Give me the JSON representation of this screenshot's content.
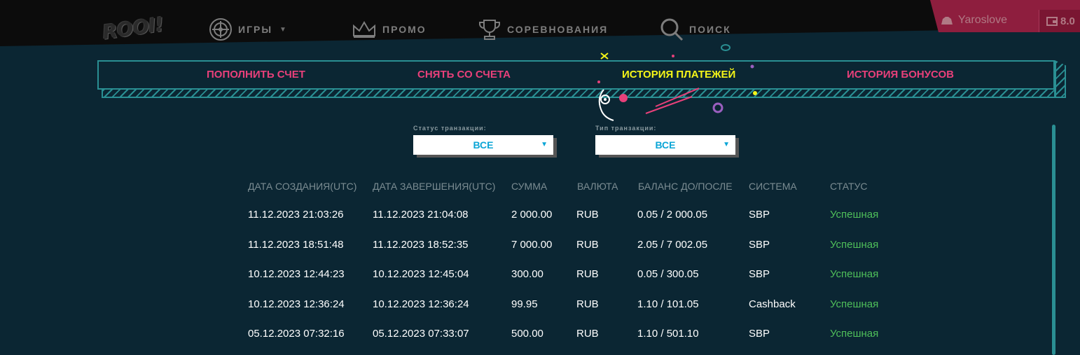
{
  "header": {
    "logo": "ROOI!",
    "nav": [
      {
        "label": "ИГРЫ",
        "icon": "roulette-icon",
        "has_dropdown": true
      },
      {
        "label": "ПРОМО",
        "icon": "crown-icon"
      },
      {
        "label": "СОРЕВНОВАНИЯ",
        "icon": "trophy-icon"
      },
      {
        "label": "ПОИСК",
        "icon": "search-icon"
      }
    ],
    "username": "Yaroslove",
    "balance": "8.0"
  },
  "tabs": [
    {
      "label": "ПОПОЛНИТЬ СЧЕТ",
      "active": false
    },
    {
      "label": "СНЯТЬ СО СЧЕТА",
      "active": false
    },
    {
      "label": "ИСТОРИЯ ПЛАТЕЖЕЙ",
      "active": true
    },
    {
      "label": "ИСТОРИЯ БОНУСОВ",
      "active": false
    }
  ],
  "filters": {
    "status": {
      "label": "Статус транзакции:",
      "value": "ВСЕ"
    },
    "type": {
      "label": "Тип транзакции:",
      "value": "ВСЕ"
    }
  },
  "table": {
    "columns": [
      "ДАТА СОЗДАНИЯ(UTC)",
      "ДАТА ЗАВЕРШЕНИЯ(UTC)",
      "СУММА",
      "ВАЛЮТА",
      "БАЛАНС ДО/ПОСЛЕ",
      "СИСТЕМА",
      "СТАТУС"
    ],
    "rows": [
      [
        "11.12.2023 21:03:26",
        "11.12.2023 21:04:08",
        "2 000.00",
        "RUB",
        "0.05 / 2 000.05",
        "SBP",
        "Успешная"
      ],
      [
        "11.12.2023 18:51:48",
        "11.12.2023 18:52:35",
        "7 000.00",
        "RUB",
        "2.05 / 7 002.05",
        "SBP",
        "Успешная"
      ],
      [
        "10.12.2023 12:44:23",
        "10.12.2023 12:45:04",
        "300.00",
        "RUB",
        "0.05 / 300.05",
        "SBP",
        "Успешная"
      ],
      [
        "10.12.2023 12:36:24",
        "10.12.2023 12:36:24",
        "99.95",
        "RUB",
        "1.10 / 101.05",
        "Cashback",
        "Успешная"
      ],
      [
        "05.12.2023 07:32:16",
        "05.12.2023 07:33:07",
        "500.00",
        "RUB",
        "1.10 / 501.10",
        "SBP",
        "Успешная"
      ]
    ]
  },
  "colors": {
    "background": "#0b2633",
    "accent": "#2a8f93",
    "tab": "#e8407a",
    "tab_active": "#f5f518",
    "status_success": "#4fbf5a",
    "select_text": "#0aa5d6"
  }
}
